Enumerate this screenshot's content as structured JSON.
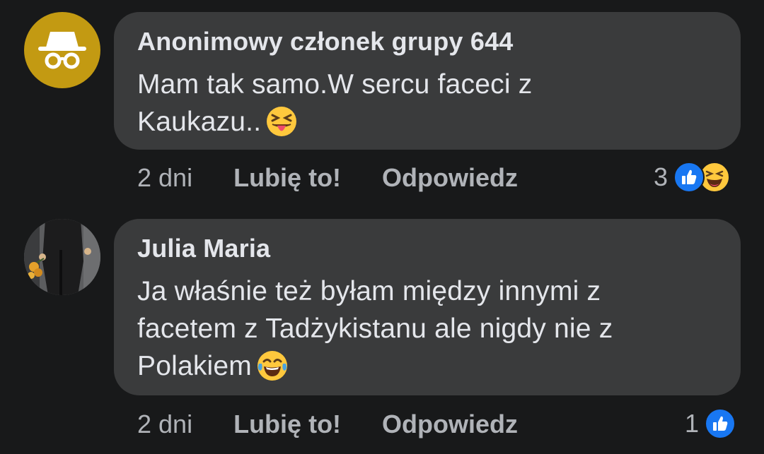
{
  "comments": [
    {
      "author": "Anonimowy członek grupy 644",
      "text": "Mam tak samo.W sercu faceci z Kaukazu..",
      "text_line1": "Mam tak samo.W sercu faceci z",
      "text_line2": "Kaukazu..",
      "avatar": "incognito-icon",
      "time": "2 dni",
      "like_label": "Lubię to!",
      "reply_label": "Odpowiedz",
      "reaction_count": "3",
      "reactions": [
        "like-icon",
        "haha-icon"
      ],
      "text_emoji": "squinting-tongue-emoji"
    },
    {
      "author": "Julia Maria",
      "text": "Ja właśnie też byłam między innymi z facetem z Tadżykistanu ale nigdy nie z Polakiem",
      "text_line1": "Ja właśnie też byłam między innymi z",
      "text_line2": "facetem z Tadżykistanu ale nigdy nie z",
      "text_line3": "Polakiem",
      "avatar": "photo-avatar",
      "time": "2 dni",
      "like_label": "Lubię to!",
      "reply_label": "Odpowiedz",
      "reaction_count": "1",
      "reactions": [
        "like-icon"
      ],
      "text_emoji": "tears-of-joy-emoji"
    }
  ],
  "colors": {
    "background": "#18191a",
    "bubble": "#3a3b3c",
    "text": "#e4e6eb",
    "secondary_text": "#b0b3b8",
    "like_blue": "#1877f2",
    "anon_avatar": "#c39a12"
  }
}
